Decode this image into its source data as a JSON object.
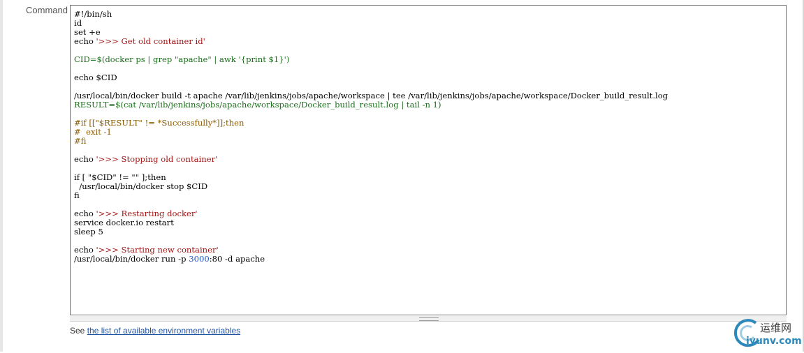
{
  "form": {
    "command_label": "Command"
  },
  "script_lines": [
    [
      [
        "#!/bin/sh",
        "plain"
      ]
    ],
    [
      [
        "id",
        "plain"
      ]
    ],
    [
      [
        "set +e",
        "plain"
      ]
    ],
    [
      [
        "echo ",
        "plain"
      ],
      [
        "'>>> Get old container id'",
        "string"
      ]
    ],
    [
      [
        "",
        "plain"
      ]
    ],
    [
      [
        "CID=$(docker ps | grep \"apache\" | awk '{print $1}')",
        "green"
      ]
    ],
    [
      [
        "",
        "plain"
      ]
    ],
    [
      [
        "echo $CID",
        "plain"
      ]
    ],
    [
      [
        "",
        "plain"
      ]
    ],
    [
      [
        "/usr/local/bin/docker build -t apache /var/lib/jenkins/jobs/apache/workspace | tee /var/lib/jenkins/jobs/apache/workspace/Docker_build_result.log",
        "plain"
      ]
    ],
    [
      [
        "RESULT=$(cat /var/lib/jenkins/jobs/apache/workspace/Docker_build_result.log | tail -n 1)",
        "green"
      ]
    ],
    [
      [
        "",
        "plain"
      ]
    ],
    [
      [
        "#if [[\"$RESULT\" != *Successfully*]];then",
        "comment"
      ]
    ],
    [
      [
        "#  exit -1",
        "comment"
      ]
    ],
    [
      [
        "#fi",
        "comment"
      ]
    ],
    [
      [
        "",
        "plain"
      ]
    ],
    [
      [
        "echo ",
        "plain"
      ],
      [
        "'>>> Stopping old container'",
        "string"
      ]
    ],
    [
      [
        "",
        "plain"
      ]
    ],
    [
      [
        "if [ \"$CID\" != \"\" ];then",
        "plain"
      ]
    ],
    [
      [
        "  /usr/local/bin/docker stop $CID",
        "plain"
      ]
    ],
    [
      [
        "fi",
        "plain"
      ]
    ],
    [
      [
        "",
        "plain"
      ]
    ],
    [
      [
        "echo ",
        "plain"
      ],
      [
        "'>>> Restarting docker'",
        "string"
      ]
    ],
    [
      [
        "service docker.io restart",
        "plain"
      ]
    ],
    [
      [
        "sleep 5",
        "plain"
      ]
    ],
    [
      [
        "",
        "plain"
      ]
    ],
    [
      [
        "echo ",
        "plain"
      ],
      [
        "'>>> Starting new container'",
        "string"
      ]
    ],
    [
      [
        "/usr/local/bin/docker run -p ",
        "plain"
      ],
      [
        "3000",
        "num"
      ],
      [
        ":80 -d apache",
        "plain"
      ]
    ]
  ],
  "help": {
    "prefix": "See ",
    "link_text": "the list of available environment variables"
  },
  "watermark": {
    "text1": "运维网",
    "text2": "iyunv.com"
  }
}
